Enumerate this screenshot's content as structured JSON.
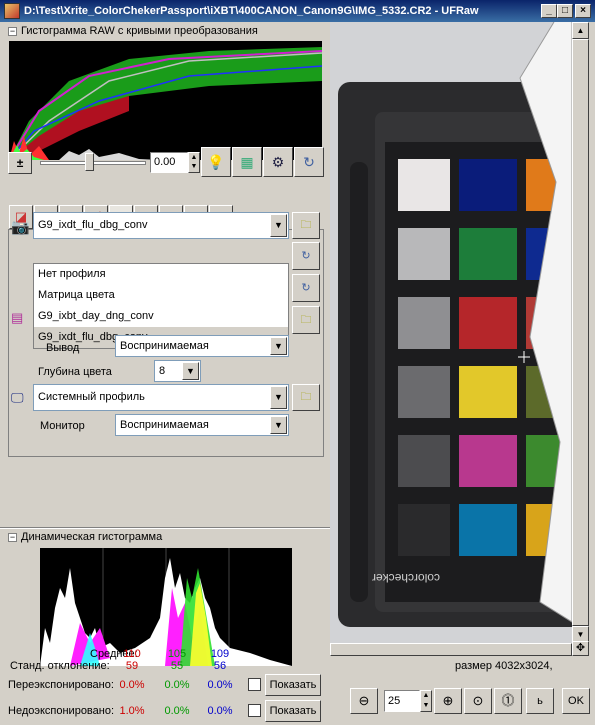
{
  "window": {
    "title": "D:\\Test\\Xrite_ColorChekerPassport\\iXBT\\400CANON_Canon9G\\IMG_5332.CR2 - UFRaw",
    "buttons": {
      "minimize": "_",
      "maximize": "□",
      "close": "×"
    }
  },
  "raw_histogram": {
    "title": "Гистограмма RAW с кривыми преобразования"
  },
  "exposure": {
    "value": "0.00"
  },
  "tabs": [
    "white-balance",
    "grayscale",
    "lens",
    "base-curve",
    "color-management",
    "corrections",
    "lightness",
    "crop",
    "exif"
  ],
  "color_mgmt": {
    "input_profile": "G9_ixdt_flu_dbg_conv",
    "dropdown_items": [
      "Нет профиля",
      "Матрица цвета",
      "G9_ixbt_day_dng_conv",
      "G9_ixdt_flu_dbg_conv"
    ],
    "selected_index": 3,
    "output_label": "Вывод",
    "output_intent": "Воспринимаемая",
    "bit_depth_label": "Глубина цвета",
    "bit_depth": "8",
    "display_profile": "Системный профиль",
    "monitor_label": "Монитор",
    "monitor_intent": "Воспринимаемая"
  },
  "dynamic_histogram": {
    "title": "Динамическая гистограмма",
    "mean_label": "Среднее:",
    "std_label": "Станд. отклонение:",
    "mean": [
      "110",
      "105",
      "109"
    ],
    "std": [
      "59",
      "55",
      "56"
    ],
    "over_label": "Переэкспонировано:",
    "under_label": "Недоэкспонировано:",
    "over": [
      "0.0%",
      "0.0%",
      "0.0%"
    ],
    "under": [
      "1.0%",
      "0.0%",
      "0.0%"
    ],
    "show_button": "Показать"
  },
  "preview": {
    "size_text": "размер 4032x3024,",
    "zoom": "25",
    "ok_label": "OK",
    "partial_label": "ь"
  },
  "colors": {
    "red": "#cc0000",
    "green": "#009900",
    "blue": "#0000cc"
  }
}
